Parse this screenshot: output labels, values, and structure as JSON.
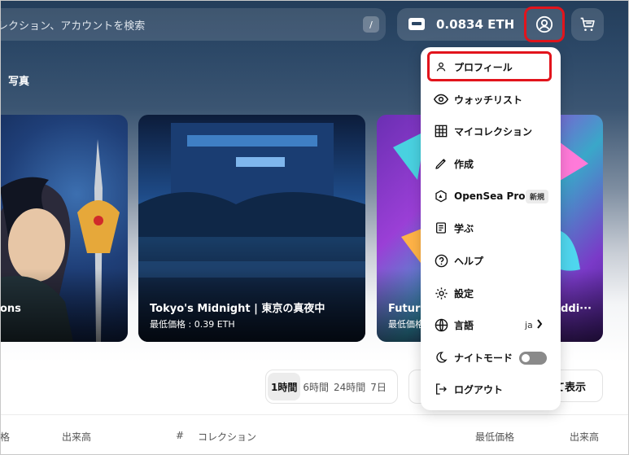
{
  "header": {
    "search_text": "レクション、アカウントを検索",
    "search_shortcut": "/",
    "wallet_balance": "0.0834 ETH"
  },
  "category": "写真",
  "cards": [
    {
      "title": "ons",
      "subtitle": ""
    },
    {
      "title": "Tokyo's Midnight | 東京の真夜中",
      "subtitle": "最低価格 : 0.39 ETH"
    },
    {
      "title": "Futur",
      "title_right": "Reddi···",
      "subtitle": "最低価格"
    }
  ],
  "time_filter": {
    "options": [
      "1時間",
      "6時間",
      "24時間",
      "7日"
    ],
    "selected": "1時間"
  },
  "show_all_label": "て表示",
  "table_headers": {
    "left_partial": "格",
    "volume_left": "出来高",
    "hash": "#",
    "collection": "コレクション",
    "floor": "最低価格",
    "volume_right": "出来高"
  },
  "menu": {
    "items": [
      {
        "label": "プロフィール",
        "icon": "user-icon"
      },
      {
        "label": "ウォッチリスト",
        "icon": "eye-icon"
      },
      {
        "label": "マイコレクション",
        "icon": "grid-icon"
      },
      {
        "label": "作成",
        "icon": "pencil-icon"
      },
      {
        "label": "OpenSea Pro",
        "icon": "opensea-pro-icon",
        "badge": "新規"
      },
      {
        "label": "学ぶ",
        "icon": "book-icon"
      },
      {
        "label": "ヘルプ",
        "icon": "help-icon"
      },
      {
        "label": "設定",
        "icon": "settings-icon"
      },
      {
        "label": "言語",
        "icon": "globe-icon",
        "value": "ja"
      },
      {
        "label": "ナイトモード",
        "icon": "moon-icon",
        "toggle_on": false
      },
      {
        "label": "ログアウト",
        "icon": "logout-icon"
      }
    ]
  },
  "colors": {
    "highlight": "#e2141c",
    "header_bg": "#233d5a"
  }
}
